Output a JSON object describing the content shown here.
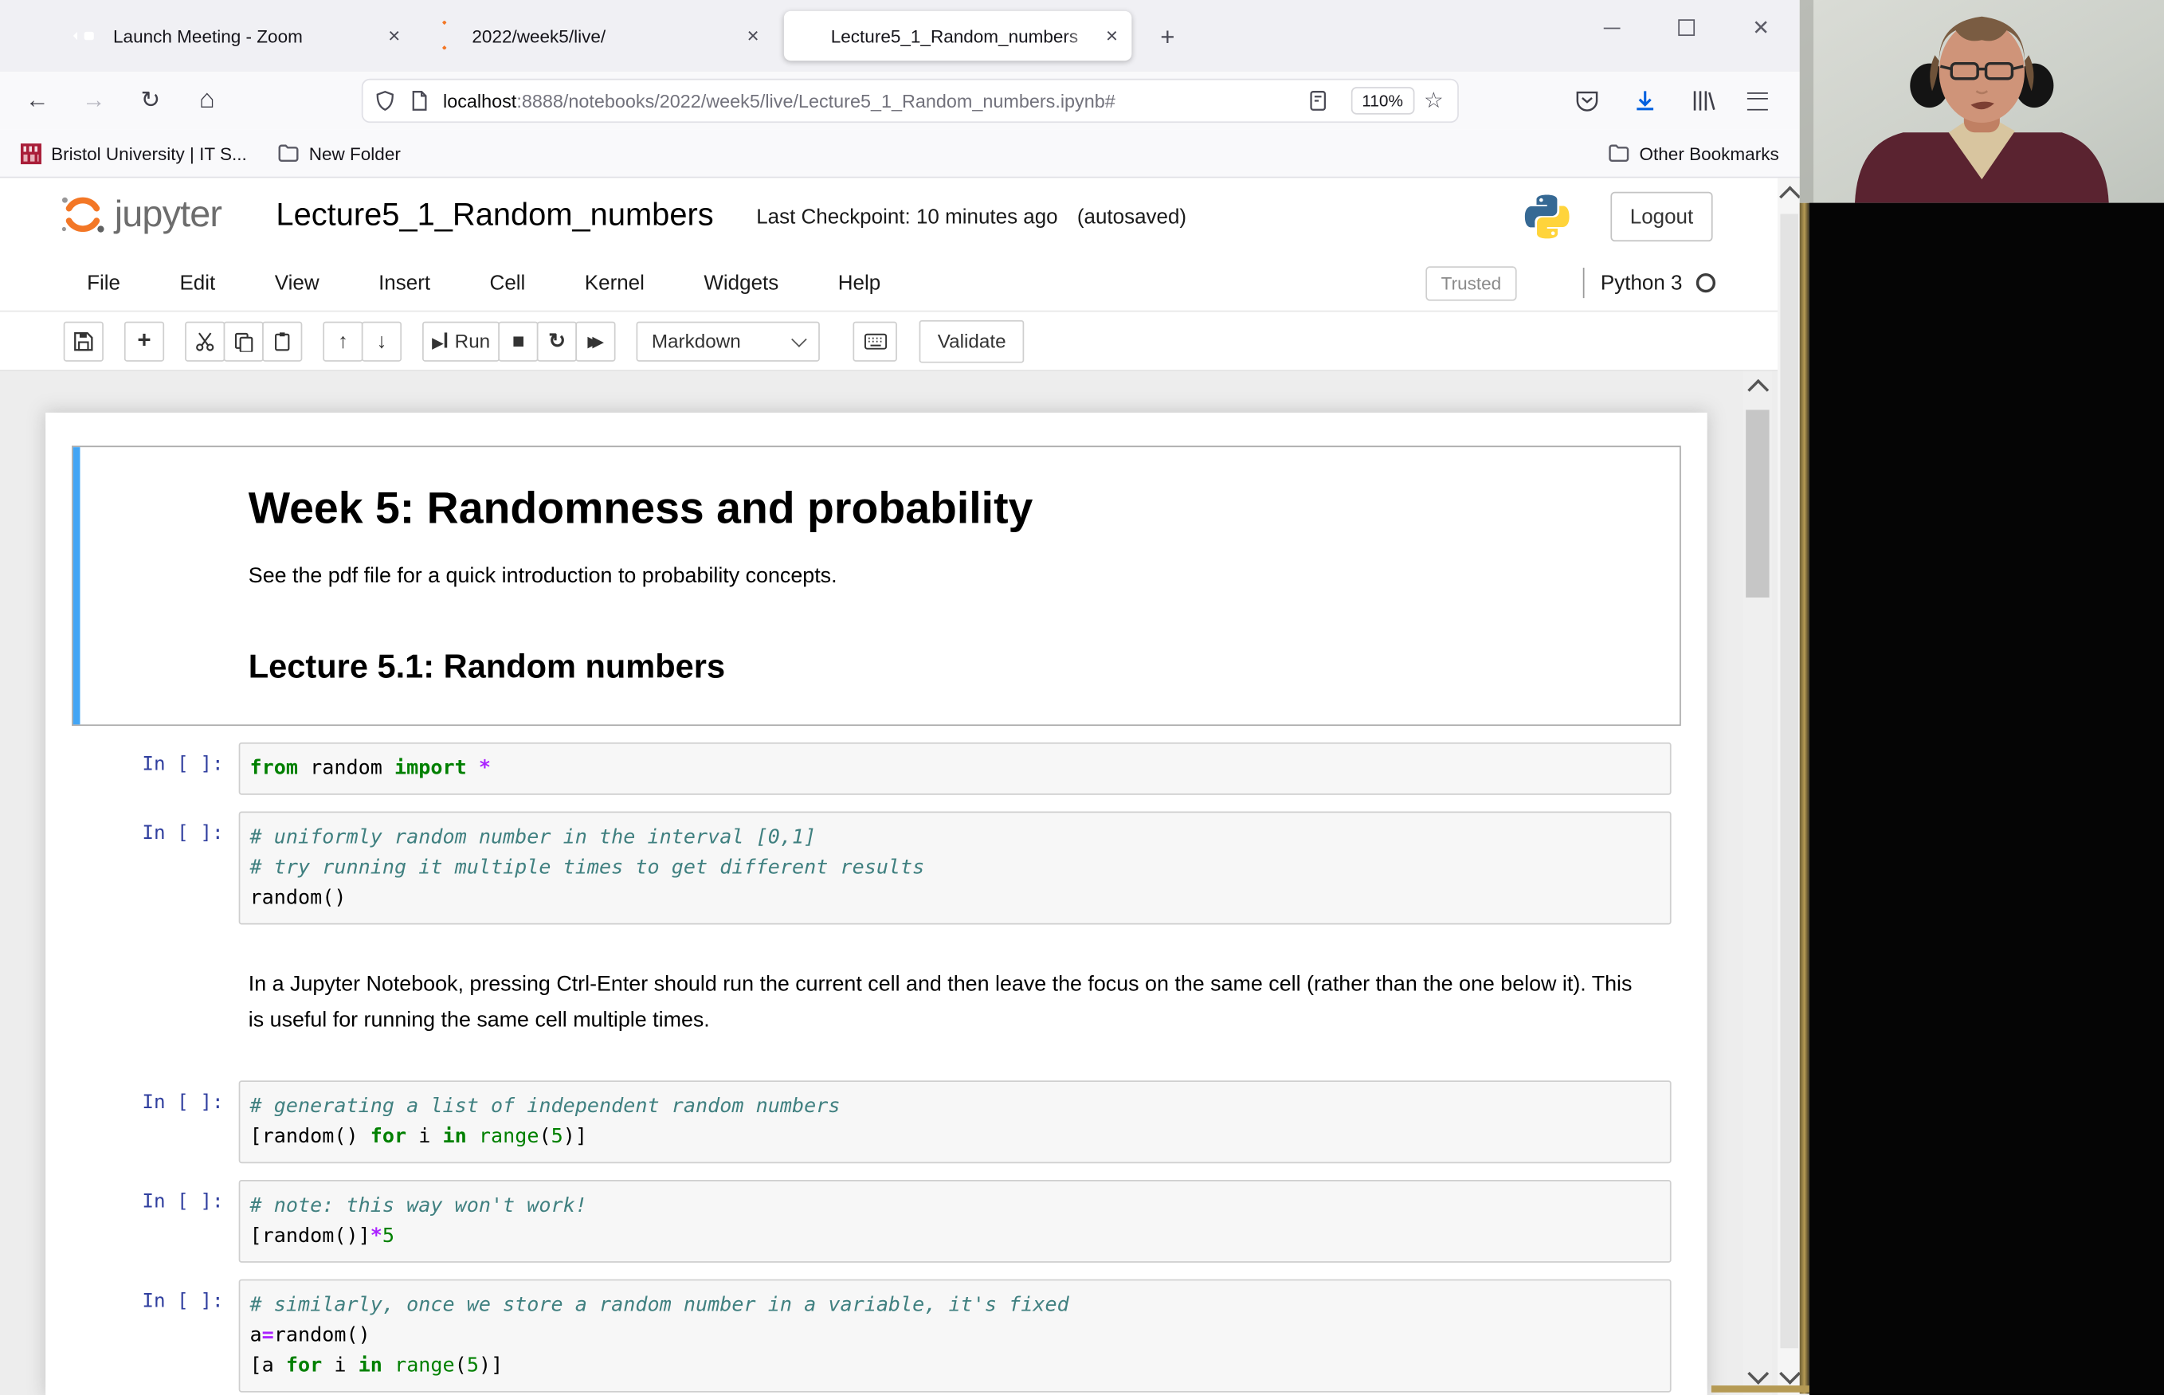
{
  "window": {
    "minimize": "minimize",
    "maximize": "maximize",
    "close": "close"
  },
  "browser": {
    "tabs": [
      {
        "title": "Launch Meeting - Zoom",
        "icon": "zoom-icon",
        "close": "×"
      },
      {
        "title": "2022/week5/live/",
        "icon": "jupyter-loading-icon",
        "close": "×"
      },
      {
        "title": "Lecture5_1_Random_numbers",
        "icon": "notebook-icon",
        "close": "×",
        "active": true
      }
    ],
    "new_tab_glyph": "+",
    "nav": {
      "back_glyph": "←",
      "forward_glyph": "→",
      "reload_glyph": "↻",
      "home_glyph": "⌂",
      "url_host": "localhost",
      "url_rest": ":8888/notebooks/2022/week5/live/Lecture5_1_Random_numbers.ipynb#",
      "zoom_level": "110%",
      "star_glyph": "☆"
    },
    "bookmarks": {
      "items": [
        {
          "label": "Bristol University | IT S...",
          "icon": "bristol-favicon"
        },
        {
          "label": "New Folder",
          "icon": "folder-icon"
        }
      ],
      "other": {
        "label": "Other Bookmarks",
        "icon": "folder-icon"
      }
    }
  },
  "jupyter": {
    "logo_text": "jupyter",
    "title": "Lecture5_1_Random_numbers",
    "checkpoint": "Last Checkpoint: 10 minutes ago",
    "autosave": "(autosaved)",
    "logout_label": "Logout",
    "menu": [
      "File",
      "Edit",
      "View",
      "Insert",
      "Cell",
      "Kernel",
      "Widgets",
      "Help"
    ],
    "trusted_label": "Trusted",
    "kernel_name": "Python 3",
    "toolbar": {
      "run_label": "Run",
      "cell_type_value": "Markdown",
      "validate_label": "Validate",
      "up_glyph": "↑",
      "down_glyph": "↓",
      "play_glyph": "▶",
      "stop_glyph": "■",
      "restart_glyph": "↻",
      "ff_glyph": "▶▶",
      "plus_glyph": "+"
    }
  },
  "notebook": {
    "cells": [
      {
        "type": "markdown",
        "selected": true,
        "blocks": [
          {
            "tag": "h1",
            "text": "Week 5: Randomness and probability"
          },
          {
            "tag": "p",
            "text": "See the pdf file for a quick introduction to probability concepts."
          },
          {
            "tag": "h2",
            "text": "Lecture 5.1: Random numbers"
          }
        ]
      },
      {
        "type": "code",
        "prompt": "In [ ]:",
        "lines": [
          [
            {
              "c": "kw",
              "v": "from"
            },
            {
              "c": "pl",
              "v": " random "
            },
            {
              "c": "kw",
              "v": "import"
            },
            {
              "c": "pl",
              "v": " "
            },
            {
              "c": "op",
              "v": "*"
            }
          ]
        ]
      },
      {
        "type": "code",
        "prompt": "In [ ]:",
        "lines": [
          [
            {
              "c": "cm",
              "v": "# uniformly random number in the interval [0,1]"
            }
          ],
          [
            {
              "c": "cm",
              "v": "# try running it multiple times to get different results"
            }
          ],
          [
            {
              "c": "pl",
              "v": "random()"
            }
          ]
        ]
      },
      {
        "type": "markdown",
        "blocks": [
          {
            "tag": "p",
            "text": "In a Jupyter Notebook, pressing Ctrl-Enter should run the current cell and then leave the focus on the same cell (rather than the one below it). This is useful for running the same cell multiple times."
          }
        ]
      },
      {
        "type": "code",
        "prompt": "In [ ]:",
        "lines": [
          [
            {
              "c": "cm",
              "v": "# generating a list of independent random numbers"
            }
          ],
          [
            {
              "c": "pl",
              "v": "[random() "
            },
            {
              "c": "kw",
              "v": "for"
            },
            {
              "c": "pl",
              "v": " i "
            },
            {
              "c": "kw",
              "v": "in"
            },
            {
              "c": "pl",
              "v": " "
            },
            {
              "c": "bi",
              "v": "range"
            },
            {
              "c": "pl",
              "v": "("
            },
            {
              "c": "num",
              "v": "5"
            },
            {
              "c": "pl",
              "v": ")]"
            }
          ]
        ]
      },
      {
        "type": "code",
        "prompt": "In [ ]:",
        "lines": [
          [
            {
              "c": "cm",
              "v": "# note: this way won't work!"
            }
          ],
          [
            {
              "c": "pl",
              "v": "[random()]"
            },
            {
              "c": "op",
              "v": "*"
            },
            {
              "c": "num",
              "v": "5"
            }
          ]
        ]
      },
      {
        "type": "code",
        "prompt": "In [ ]:",
        "lines": [
          [
            {
              "c": "cm",
              "v": "# similarly, once we store a random number in a variable, it's fixed"
            }
          ],
          [
            {
              "c": "pl",
              "v": "a"
            },
            {
              "c": "op",
              "v": "="
            },
            {
              "c": "pl",
              "v": "random()"
            }
          ],
          [
            {
              "c": "pl",
              "v": "[a "
            },
            {
              "c": "kw",
              "v": "for"
            },
            {
              "c": "pl",
              "v": " i "
            },
            {
              "c": "kw",
              "v": "in"
            },
            {
              "c": "pl",
              "v": " "
            },
            {
              "c": "bi",
              "v": "range"
            },
            {
              "c": "pl",
              "v": "("
            },
            {
              "c": "num",
              "v": "5"
            },
            {
              "c": "pl",
              "v": ")]"
            }
          ]
        ]
      }
    ]
  },
  "colors": {
    "selected_cell_accent": "#42A5F5",
    "prompt_blue": "#303F9F",
    "syntax_keyword": "#008000",
    "syntax_operator": "#AA22FF",
    "syntax_number": "#008000",
    "syntax_comment": "#408080",
    "jupyter_orange": "#F37726",
    "download_blue": "#0060df",
    "zoom_brand_blue": "#2d8cff",
    "bristol_red": "#a91e39"
  }
}
